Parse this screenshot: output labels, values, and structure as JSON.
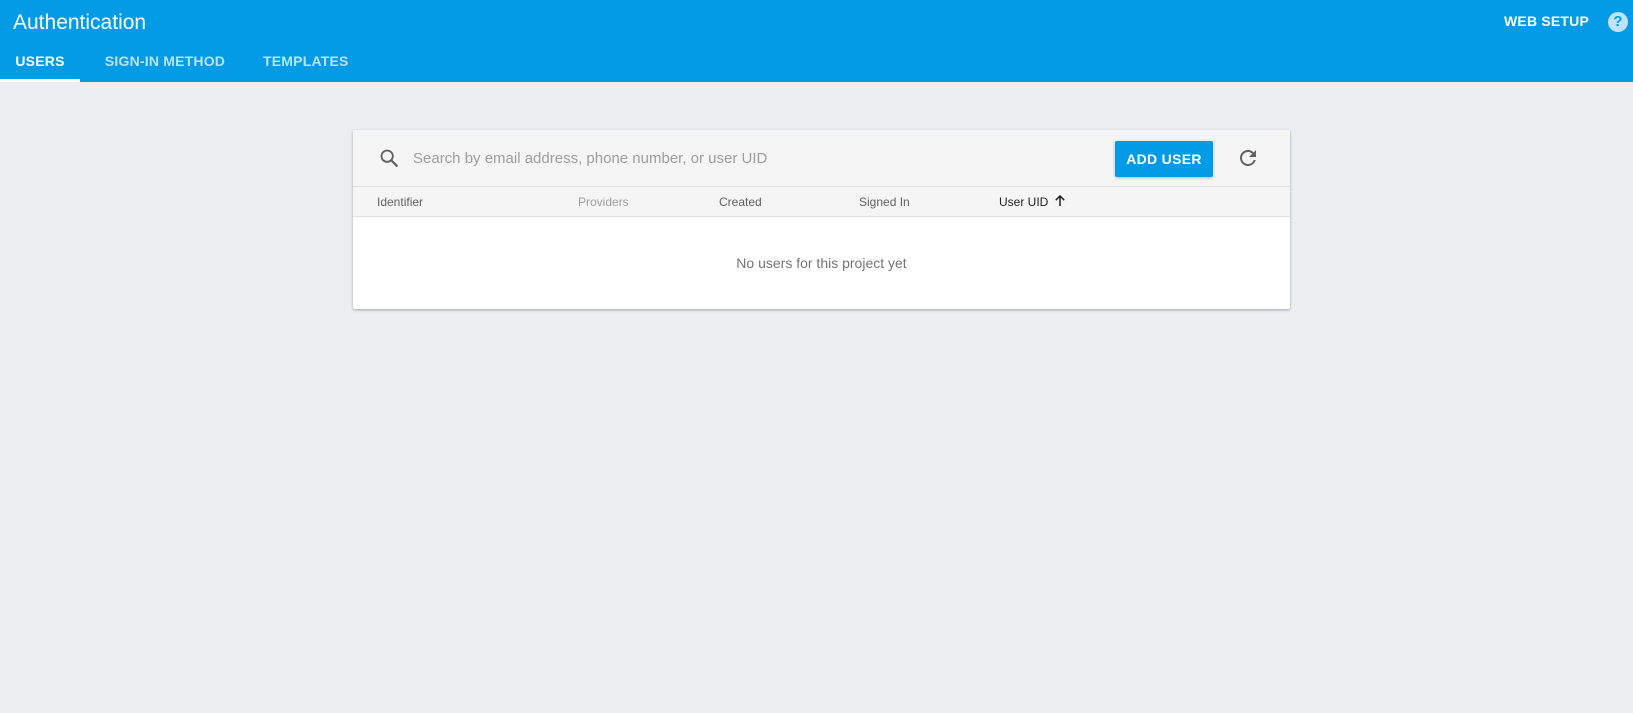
{
  "app_bar": {
    "title": "Authentication",
    "web_setup_label": "WEB SETUP",
    "help_label": "?",
    "tabs": [
      {
        "label": "USERS",
        "active": true
      },
      {
        "label": "SIGN-IN METHOD",
        "active": false
      },
      {
        "label": "TEMPLATES",
        "active": false
      }
    ]
  },
  "users_card": {
    "search": {
      "placeholder": "Search by email address, phone number, or user UID",
      "value": ""
    },
    "add_user_label": "ADD USER",
    "columns": [
      {
        "label": "Identifier"
      },
      {
        "label": "Providers"
      },
      {
        "label": "Created"
      },
      {
        "label": "Signed In"
      },
      {
        "label": "User UID",
        "sort": "ascending"
      }
    ],
    "empty_message": "No users for this project yet"
  },
  "icons": {
    "search": "search-icon",
    "refresh": "refresh-icon",
    "sort": "arrow-up-icon",
    "help": "help-icon"
  },
  "colors": {
    "brand": "#039be5",
    "background": "#eceff1",
    "toolbar": "#f5f5f5"
  }
}
